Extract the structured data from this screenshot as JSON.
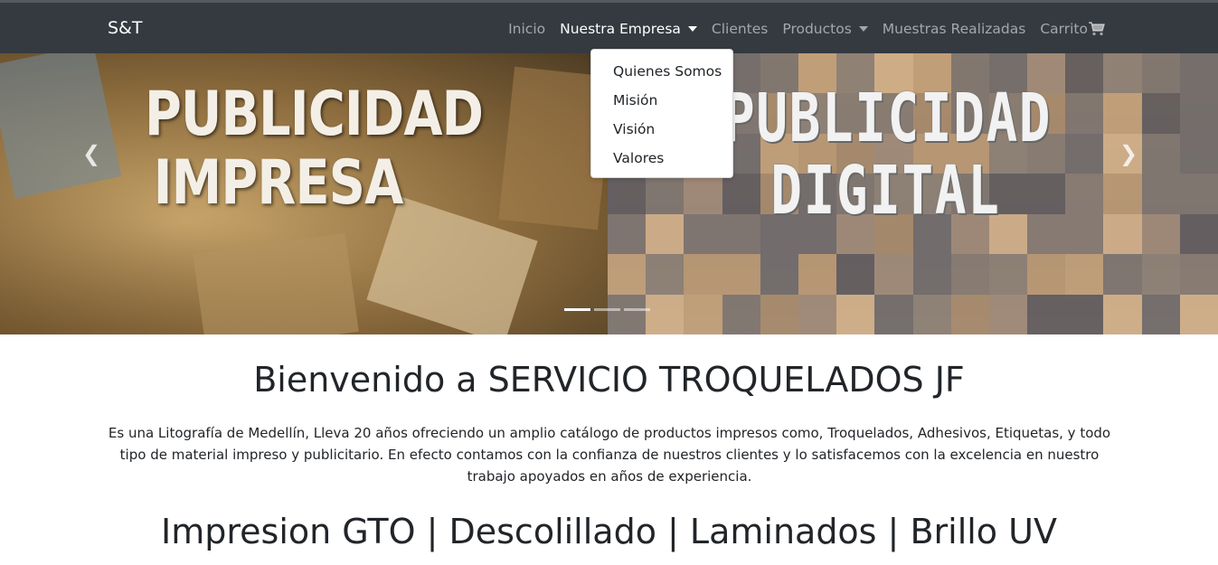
{
  "navbar": {
    "brand": "S&T",
    "links": [
      {
        "label": "Inicio"
      },
      {
        "label": "Nuestra Empresa"
      },
      {
        "label": "Clientes"
      },
      {
        "label": "Productos"
      },
      {
        "label": "Muestras Realizadas"
      },
      {
        "label": "Carrito"
      }
    ],
    "cart_icon": "shopping-cart-icon"
  },
  "dropdown": {
    "items": [
      "Quienes Somos",
      "Misión",
      "Visión",
      "Valores"
    ]
  },
  "carousel": {
    "slide_left_text": "PUBLICIDAD IMPRESA",
    "slide_right_text": "PUBLICIDAD DIGITAL",
    "prev_icon": "chevron-left-icon",
    "next_icon": "chevron-right-icon",
    "indicator_count": 3,
    "active_indicator": 1
  },
  "main": {
    "title": "Bienvenido a SERVICIO TROQUELADOS JF",
    "description": "Es una Litografía de Medellín, Lleva 20 años ofreciendo un amplio catálogo de productos impresos como, Troquelados, Adhesivos, Etiquetas, y todo tipo de material impreso y publicitario. En efecto contamos con la confianza de nuestros clientes y lo satisfacemos con la excelencia en nuestro trabajo apoyados en años de experiencia.",
    "services": "Impresion GTO | Descolillado | Laminados | Brillo UV"
  },
  "colors": {
    "navbar": "#343a40",
    "nav_link": "rgba(255,255,255,0.55)",
    "nav_active": "#ffffff"
  }
}
